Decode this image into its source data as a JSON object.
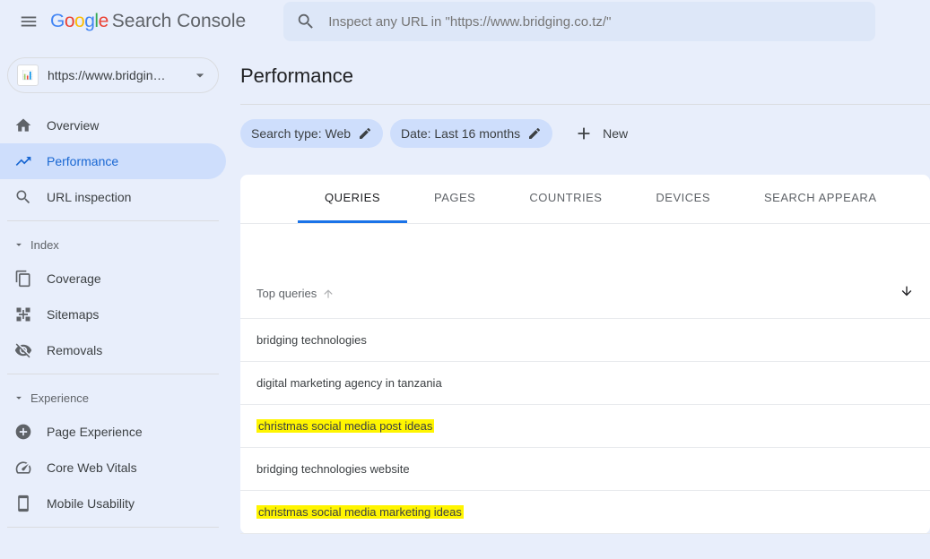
{
  "header": {
    "brand1": "G",
    "brand2": "o",
    "brand3": "o",
    "brand4": "g",
    "brand5": "l",
    "brand6": "e",
    "brand_suffix": "Search Console",
    "search_placeholder": "Inspect any URL in \"https://www.bridging.co.tz/\""
  },
  "property": {
    "text": "https://www.bridgin…"
  },
  "nav": {
    "overview": "Overview",
    "performance": "Performance",
    "url_inspection": "URL inspection",
    "index_section": "Index",
    "coverage": "Coverage",
    "sitemaps": "Sitemaps",
    "removals": "Removals",
    "experience_section": "Experience",
    "page_experience": "Page Experience",
    "core_web_vitals": "Core Web Vitals",
    "mobile_usability": "Mobile Usability"
  },
  "main": {
    "title": "Performance",
    "filters": {
      "search_type": "Search type: Web",
      "date": "Date: Last 16 months",
      "new": "New"
    },
    "tabs": {
      "queries": "QUERIES",
      "pages": "PAGES",
      "countries": "COUNTRIES",
      "devices": "DEVICES",
      "search_appearance": "SEARCH APPEARA"
    },
    "table": {
      "header_left": "Top queries",
      "rows": [
        {
          "text": "bridging technologies",
          "highlight": false
        },
        {
          "text": "digital marketing agency in tanzania",
          "highlight": false
        },
        {
          "text": "christmas social media post ideas",
          "highlight": true
        },
        {
          "text": "bridging technologies website",
          "highlight": false
        },
        {
          "text": "christmas social media marketing ideas",
          "highlight": true
        }
      ]
    }
  }
}
